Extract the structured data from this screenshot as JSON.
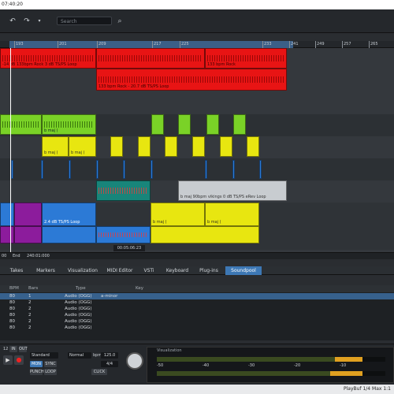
{
  "titlebar": {
    "time": "07:40:20"
  },
  "toolbar": {
    "search_placeholder": "Search",
    "undo_icon": "undo-icon",
    "redo_icon": "redo-icon",
    "search_icon": "search-icon"
  },
  "ruler": {
    "ticks": [
      "193",
      "201",
      "209",
      "217",
      "225",
      "233",
      "241",
      "249",
      "257",
      "265"
    ]
  },
  "arranger": {
    "clip_labels": {
      "red_top_1": "-14 dB 133bpm Rock 3 dB TS/PS Loop",
      "red_top_2": "133 bpm Rock",
      "red_mid": "133 bpm Rock - 20.7 dB TS/PS Loop",
      "green_1": "b maj (",
      "yellow_1": "b maj (",
      "yellow_2": "b maj (",
      "gray_1": "b maj 90bpm vikings 0 dB TS/PS eRev Loop",
      "blue_1": "2.4 dB TS/PS Loop",
      "yellow_bottom_1": "b maj (",
      "yellow_bottom_2": "b maj ("
    },
    "position_marker": "00:05:06:23"
  },
  "timeline": {
    "start": "00",
    "end_label": "End",
    "end_value": "240:01:000"
  },
  "tabs": [
    "Takes",
    "Markers",
    "Visualization",
    "MIDI Editor",
    "VSTi",
    "Keyboard",
    "Plug-ins",
    "Soundpool"
  ],
  "active_tab": "Soundpool",
  "pool": {
    "columns": [
      "BPM",
      "Bars",
      "Type",
      "Key"
    ],
    "rows": [
      {
        "bpm": "80",
        "bars": "1",
        "type": "Audio (OGG)",
        "key": "a-minor",
        "selected": true
      },
      {
        "bpm": "80",
        "bars": "2",
        "type": "Audio (OGG)",
        "key": "",
        "selected": false
      },
      {
        "bpm": "80",
        "bars": "2",
        "type": "Audio (OGG)",
        "key": "",
        "selected": false
      },
      {
        "bpm": "80",
        "bars": "2",
        "type": "Audio (OGG)",
        "key": "",
        "selected": false
      },
      {
        "bpm": "80",
        "bars": "2",
        "type": "Audio (OGG)",
        "key": "",
        "selected": false
      },
      {
        "bpm": "80",
        "bars": "2",
        "type": "Audio (OGG)",
        "key": "",
        "selected": false
      }
    ]
  },
  "transport": {
    "position": "12",
    "in_label": "IN",
    "out_label": "OUT",
    "mode": "Standard",
    "mode_normal": "Normal",
    "mon": "MON",
    "sync": "SYNC",
    "punch": "PUNCH",
    "loop": "LOOP",
    "bpm_label": "bpm",
    "bpm_value": "125.0",
    "time_sig": "4/4",
    "click": "CLICK",
    "visualization_label": "Visualization",
    "meter_scale": [
      "-50",
      "-40",
      "-30",
      "-20",
      "-10"
    ]
  },
  "status": {
    "text": "PlayBuf 1/4  Max 1:1"
  },
  "colors": {
    "accent": "#3d78b5",
    "red": "#e81414",
    "green": "#7ad227",
    "yellow": "#e8e610",
    "blue": "#2c7ad6",
    "purple": "#8c1c9c"
  }
}
